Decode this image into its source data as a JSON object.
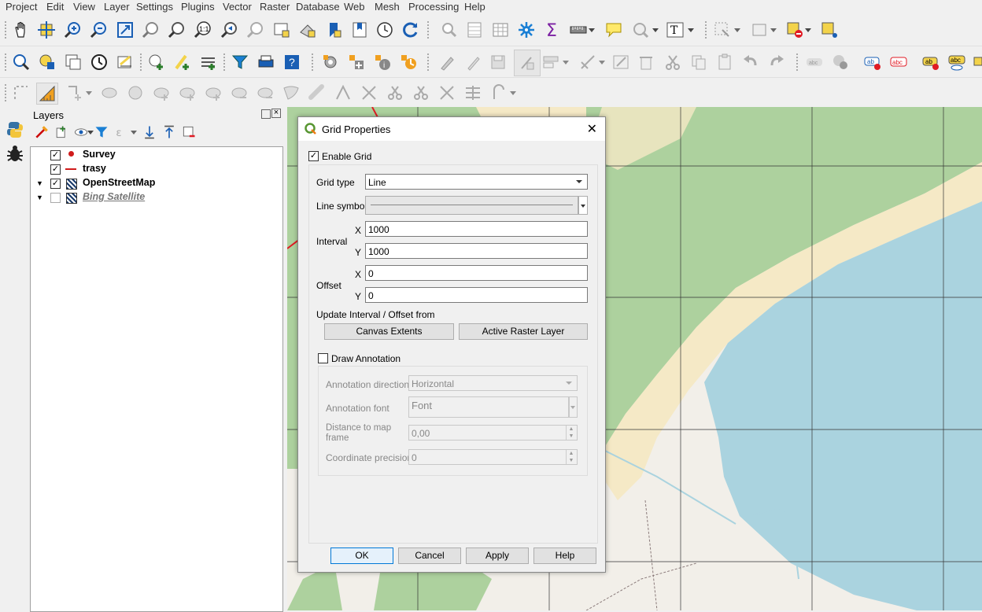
{
  "menu": [
    "Project",
    "Edit",
    "View",
    "Layer",
    "Settings",
    "Plugins",
    "Vector",
    "Raster",
    "Database",
    "Web",
    "Mesh",
    "Processing",
    "Help"
  ],
  "layers_panel": {
    "title": "Layers",
    "layers": [
      {
        "name": "Survey",
        "checked": true,
        "icon": "point-layer-icon",
        "expanded": null
      },
      {
        "name": "trasy",
        "checked": true,
        "icon": "line-layer-icon",
        "expanded": null
      },
      {
        "name": "OpenStreetMap",
        "checked": true,
        "icon": "raster-layer-icon",
        "expanded": true
      },
      {
        "name": "Bing Satellite",
        "checked": false,
        "icon": "raster-layer-icon",
        "expanded": true
      }
    ]
  },
  "dialog": {
    "title": "Grid Properties",
    "enable_grid_label": "Enable Grid",
    "enable_grid_checked": true,
    "grid_type_label": "Grid type",
    "grid_type_value": "Line",
    "line_symbol_label": "Line symbol",
    "interval_label": "Interval",
    "interval_x_label": "X",
    "interval_x": "1000",
    "interval_y_label": "Y",
    "interval_y": "1000",
    "offset_label": "Offset",
    "offset_x_label": "X",
    "offset_x": "0",
    "offset_y_label": "Y",
    "offset_y": "0",
    "update_label": "Update Interval / Offset from",
    "canvas_extents": "Canvas Extents",
    "active_raster": "Active Raster Layer",
    "draw_annotation_label": "Draw Annotation",
    "draw_annotation_checked": false,
    "annotation_direction_label": "Annotation direction",
    "annotation_direction_value": "Horizontal",
    "annotation_font_label": "Annotation font",
    "annotation_font_value": "Font",
    "distance_label_1": "Distance to map",
    "distance_label_2": "frame",
    "distance_value": "0,00",
    "precision_label": "Coordinate precision",
    "precision_value": "0",
    "ok": "OK",
    "cancel": "Cancel",
    "apply": "Apply",
    "help": "Help"
  },
  "colors": {
    "water": "#aad3df",
    "green": "#add19e",
    "sand": "#f5e9c6",
    "land": "#f2efe9",
    "accent": "#0078d7"
  }
}
